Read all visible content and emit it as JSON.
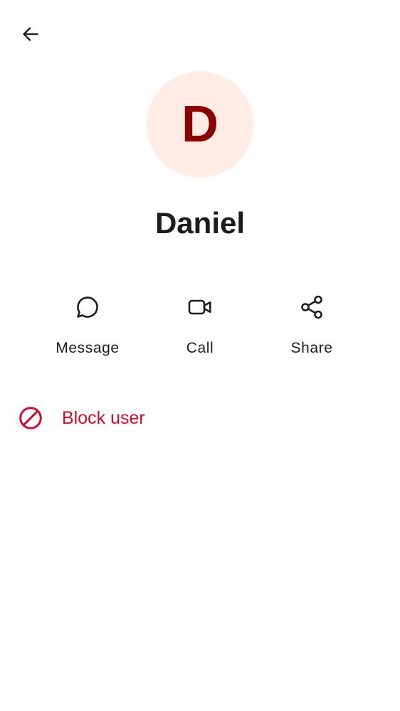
{
  "header": {
    "back_icon": "arrow-back-icon"
  },
  "contact": {
    "avatar_letter": "D",
    "name": "Daniel"
  },
  "actions": [
    {
      "label": "Message",
      "icon": "chat-bubble-icon"
    },
    {
      "label": "Call",
      "icon": "video-camera-icon"
    },
    {
      "label": "Share",
      "icon": "share-icon"
    }
  ],
  "block": {
    "label": "Block user",
    "icon": "block-icon"
  },
  "colors": {
    "avatar_background": "#ffede5",
    "avatar_letter": "#8b0000",
    "text_primary": "#1d1b20",
    "danger": "#c8102e"
  }
}
